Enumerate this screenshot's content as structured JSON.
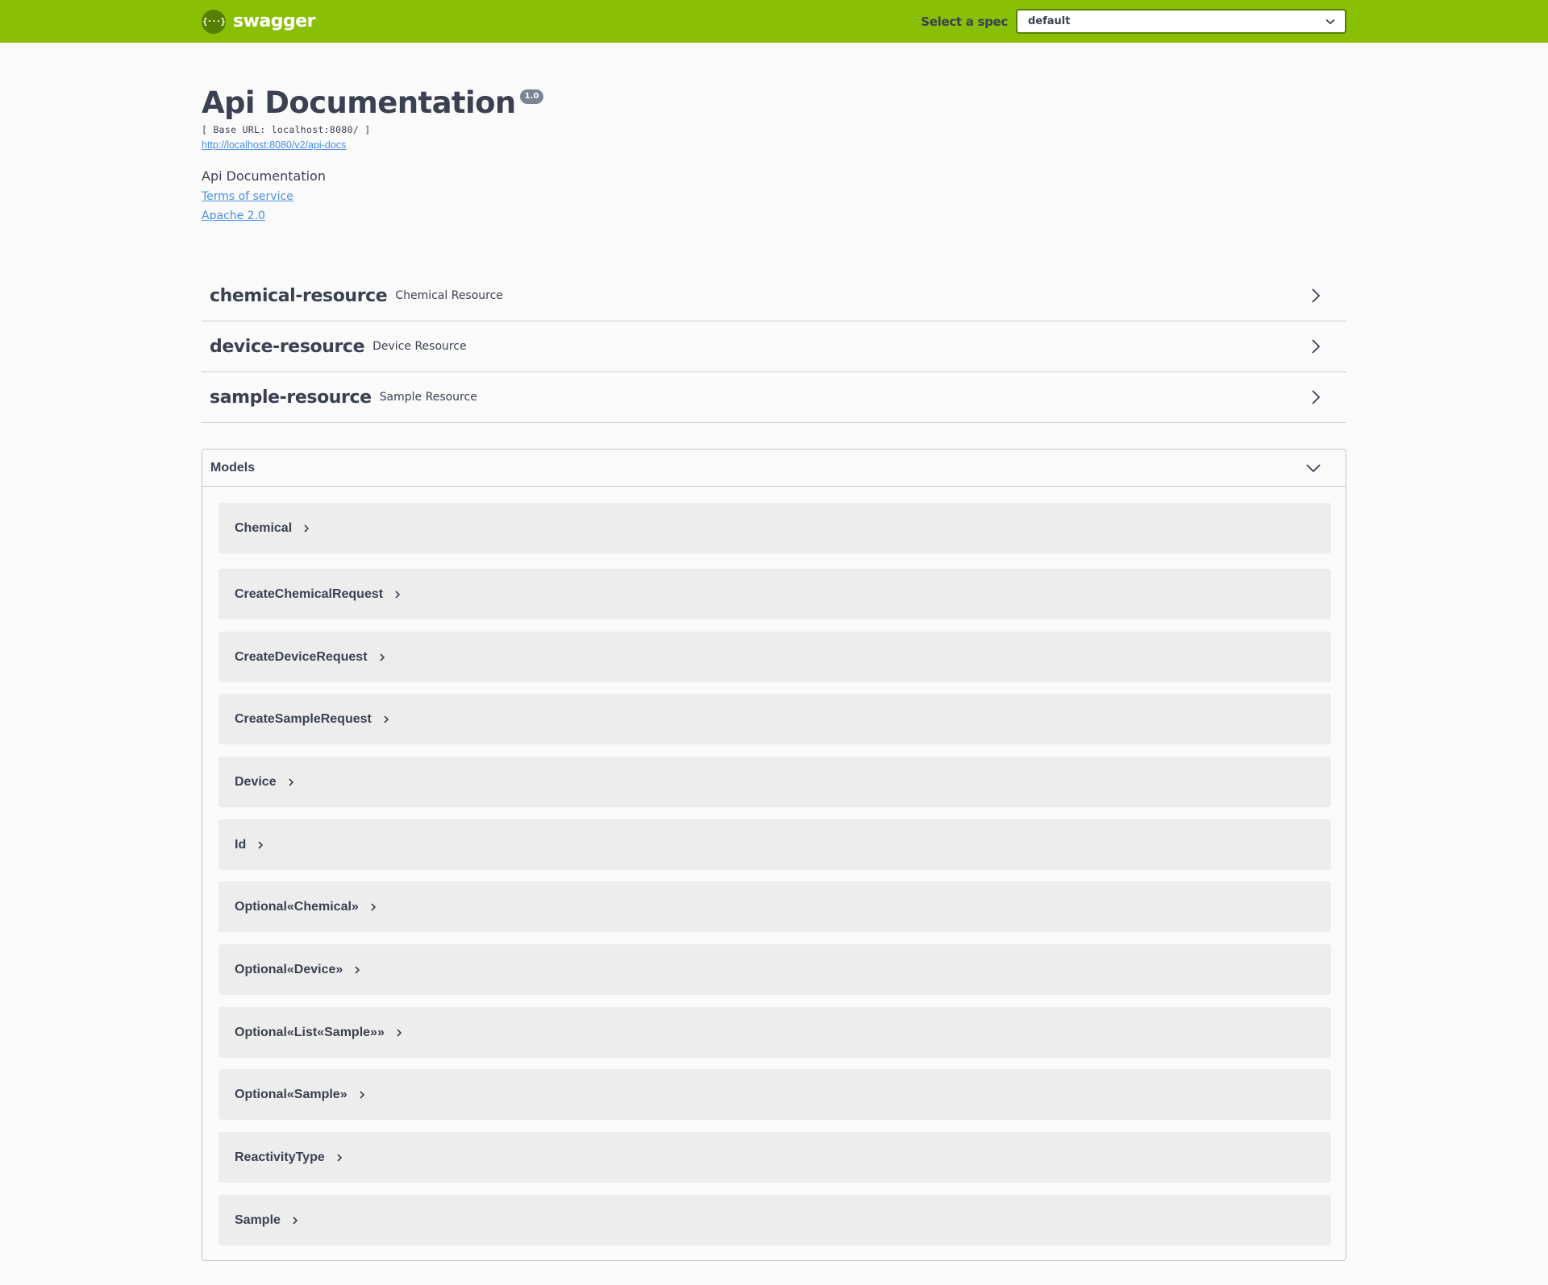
{
  "topbar": {
    "brand_icon": "{···}",
    "brand_text": "swagger",
    "spec_label": "Select a spec",
    "spec_value": "default",
    "color": "#89bf04"
  },
  "info": {
    "title": "Api Documentation",
    "version": "1.0",
    "base_url": "[ Base URL: localhost:8080/ ]",
    "api_docs_link": "http://localhost:8080/v2/api-docs",
    "description": "Api Documentation",
    "terms_link": "Terms of service",
    "license_link": "Apache 2.0"
  },
  "tags": [
    {
      "name": "chemical-resource",
      "description": "Chemical Resource"
    },
    {
      "name": "device-resource",
      "description": "Device Resource"
    },
    {
      "name": "sample-resource",
      "description": "Sample Resource"
    }
  ],
  "models": {
    "title": "Models",
    "items": [
      "Chemical",
      "CreateChemicalRequest",
      "CreateDeviceRequest",
      "CreateSampleRequest",
      "Device",
      "Id",
      "Optional«Chemical»",
      "Optional«Device»",
      "Optional«List«Sample»»",
      "Optional«Sample»",
      "ReactivityType",
      "Sample"
    ]
  }
}
